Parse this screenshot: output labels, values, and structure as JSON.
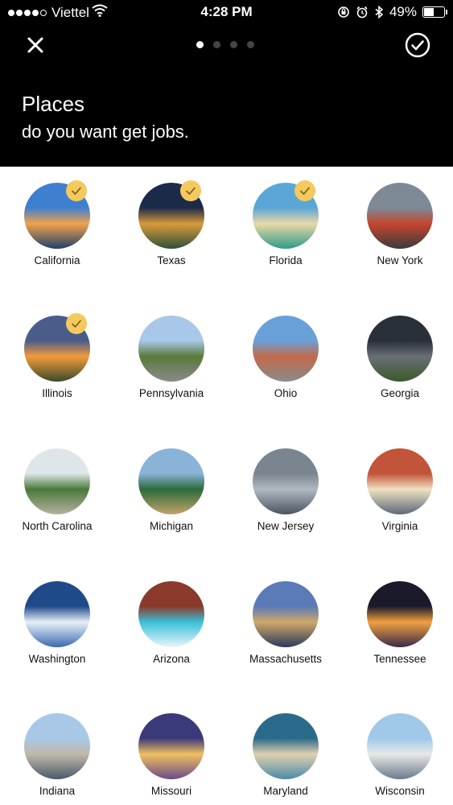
{
  "status_bar": {
    "carrier": "Viettel",
    "time": "4:28 PM",
    "battery": "49%"
  },
  "header": {
    "title": "Places",
    "subtitle": "do you want get jobs.",
    "pager": {
      "total": 4,
      "active": 0
    }
  },
  "places": [
    {
      "name": "California",
      "selected": true,
      "colors": [
        "#3f7fd0",
        "#f0a24a",
        "#1e3f6b"
      ]
    },
    {
      "name": "Texas",
      "selected": true,
      "colors": [
        "#1c2a4a",
        "#d79a3a",
        "#2e4f3a"
      ]
    },
    {
      "name": "Florida",
      "selected": true,
      "colors": [
        "#5aa6d6",
        "#e9d8a6",
        "#2e9b8a"
      ]
    },
    {
      "name": "New York",
      "selected": false,
      "colors": [
        "#7d8a96",
        "#c4452e",
        "#3b3b3b"
      ]
    },
    {
      "name": "Illinois",
      "selected": true,
      "colors": [
        "#4a5d8a",
        "#f29a3a",
        "#3b4a2a"
      ]
    },
    {
      "name": "Pennsylvania",
      "selected": false,
      "colors": [
        "#a9c7e8",
        "#5a7a3a",
        "#8a8a8a"
      ]
    },
    {
      "name": "Ohio",
      "selected": false,
      "colors": [
        "#6aa0d8",
        "#c26a4a",
        "#8a8a8a"
      ]
    },
    {
      "name": "Georgia",
      "selected": false,
      "colors": [
        "#2a3038",
        "#6a6f75",
        "#3a5a2a"
      ]
    },
    {
      "name": "North Carolina",
      "selected": false,
      "colors": [
        "#dfe6ea",
        "#4a7a3a",
        "#b8b0a0"
      ]
    },
    {
      "name": "Michigan",
      "selected": false,
      "colors": [
        "#8ab3d8",
        "#2a6a3a",
        "#c4a36a"
      ]
    },
    {
      "name": "New Jersey",
      "selected": false,
      "colors": [
        "#7a8590",
        "#b0b8c0",
        "#4a5560"
      ]
    },
    {
      "name": "Virginia",
      "selected": false,
      "colors": [
        "#c2543a",
        "#f0e0c0",
        "#5a6a7a"
      ]
    },
    {
      "name": "Washington",
      "selected": false,
      "colors": [
        "#1f4a8a",
        "#e8f0f8",
        "#3a6ab0"
      ]
    },
    {
      "name": "Arizona",
      "selected": false,
      "colors": [
        "#8a3a2a",
        "#3ac0d8",
        "#e9f6fa"
      ]
    },
    {
      "name": "Massachusetts",
      "selected": false,
      "colors": [
        "#5a7ab8",
        "#d0a86a",
        "#2a3a5a"
      ]
    },
    {
      "name": "Tennessee",
      "selected": false,
      "colors": [
        "#1a1a2a",
        "#f0a040",
        "#3a2a4a"
      ]
    },
    {
      "name": "Indiana",
      "selected": false,
      "colors": [
        "#a9c8e8",
        "#c0b8a8",
        "#4a5a6a"
      ]
    },
    {
      "name": "Missouri",
      "selected": false,
      "colors": [
        "#3a3a7a",
        "#f0c060",
        "#6a4a8a"
      ]
    },
    {
      "name": "Maryland",
      "selected": false,
      "colors": [
        "#2a6a8a",
        "#e0d0b0",
        "#4a8aa8"
      ]
    },
    {
      "name": "Wisconsin",
      "selected": false,
      "colors": [
        "#a0c8e8",
        "#e8e8e8",
        "#6a7a8a"
      ]
    }
  ],
  "icons": {
    "close": "close-icon",
    "confirm": "check-circle-icon",
    "selected": "checkmark-icon"
  },
  "colors": {
    "header_bg": "#000000",
    "badge": "#f4c95d",
    "text": "#111111"
  }
}
